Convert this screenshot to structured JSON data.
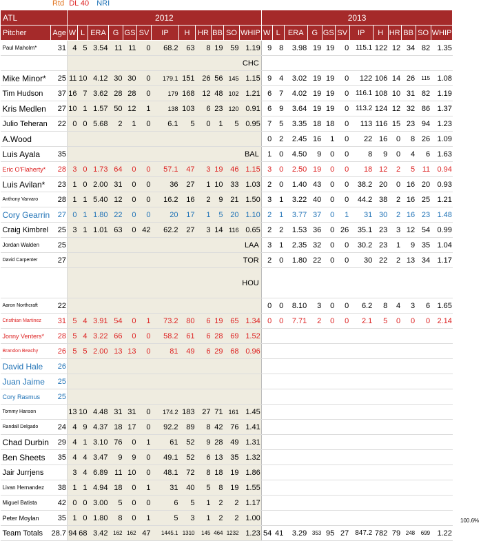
{
  "legend": {
    "rtd": "Rtd",
    "dl40": "DL 40",
    "nri": "NRI"
  },
  "colors": {
    "header_bg": "#a52a2a",
    "red": "#dd2222",
    "blue": "#1f72b6",
    "orange": "#e0701a",
    "year2012_bg": "#efece0"
  },
  "header": {
    "team": "ATL",
    "year1": "2012",
    "year2": "2013",
    "columns": [
      "Pitcher",
      "Age",
      "W",
      "L",
      "ERA",
      "G",
      "GS",
      "SV",
      "IP",
      "H",
      "HR",
      "BB",
      "SO",
      "WHIP",
      "W",
      "L",
      "ERA",
      "G",
      "GS",
      "SV",
      "IP",
      "H",
      "HR",
      "BB",
      "SO",
      "WHIP"
    ]
  },
  "rows": [
    {
      "name": "Paul Maholm*",
      "size": "fs8",
      "age": "31",
      "s12": [
        "4",
        "5",
        "3.54",
        "11",
        "11",
        "0",
        "68.2",
        "63",
        "8",
        "19",
        "59",
        "1.19"
      ],
      "s13": [
        "9",
        "8",
        "3.98",
        "19",
        "19",
        "0",
        "115.1",
        "122",
        "12",
        "34",
        "82",
        "1.35"
      ]
    },
    {
      "team": "CHC"
    },
    {
      "name": "Mike Minor*",
      "size": "fs12",
      "age": "25",
      "s12": [
        "11",
        "10",
        "4.12",
        "30",
        "30",
        "0",
        "179.1",
        "151",
        "26",
        "56",
        "145",
        "1.15"
      ],
      "s13": [
        "9",
        "4",
        "3.02",
        "19",
        "19",
        "0",
        "122",
        "106",
        "14",
        "26",
        "115",
        "1.08"
      ]
    },
    {
      "name": "Tim Hudson",
      "size": "",
      "age": "37",
      "s12": [
        "16",
        "7",
        "3.62",
        "28",
        "28",
        "0",
        "179",
        "168",
        "12",
        "48",
        "102",
        "1.21"
      ],
      "s13": [
        "6",
        "7",
        "4.02",
        "19",
        "19",
        "0",
        "116.1",
        "108",
        "10",
        "31",
        "82",
        "1.19"
      ]
    },
    {
      "name": "Kris Medlen",
      "size": "fs12",
      "age": "27",
      "s12": [
        "10",
        "1",
        "1.57",
        "50",
        "12",
        "1",
        "138",
        "103",
        "6",
        "23",
        "120",
        "0.91"
      ],
      "s13": [
        "6",
        "9",
        "3.64",
        "19",
        "19",
        "0",
        "113.2",
        "124",
        "12",
        "32",
        "86",
        "1.37"
      ]
    },
    {
      "name": "Julio Teheran",
      "size": "",
      "age": "22",
      "s12": [
        "0",
        "0",
        "5.68",
        "2",
        "1",
        "0",
        "6.1",
        "5",
        "0",
        "1",
        "5",
        "0.95"
      ],
      "s13": [
        "7",
        "5",
        "3.35",
        "18",
        "18",
        "0",
        "113",
        "116",
        "15",
        "23",
        "94",
        "1.23"
      ]
    },
    {
      "name": "A.Wood",
      "size": "fs12",
      "age": "",
      "s12": [],
      "s13": [
        "0",
        "2",
        "2.45",
        "16",
        "1",
        "0",
        "22",
        "16",
        "0",
        "8",
        "26",
        "1.09"
      ]
    },
    {
      "name": "Luis Ayala",
      "size": "fs12",
      "age": "35",
      "team": "BAL",
      "s13": [
        "1",
        "0",
        "4.50",
        "9",
        "0",
        "0",
        "8",
        "9",
        "0",
        "4",
        "6",
        "1.63"
      ]
    },
    {
      "name": "Eric O'Flaherty*",
      "size": "fs9",
      "age": "28",
      "color": "red",
      "s12": [
        "3",
        "0",
        "1.73",
        "64",
        "0",
        "0",
        "57.1",
        "47",
        "3",
        "19",
        "46",
        "1.15"
      ],
      "s13": [
        "3",
        "0",
        "2.50",
        "19",
        "0",
        "0",
        "18",
        "12",
        "2",
        "5",
        "11",
        "0.94"
      ]
    },
    {
      "name": "Luis Avilan*",
      "size": "fs12",
      "age": "23",
      "s12": [
        "1",
        "0",
        "2.00",
        "31",
        "0",
        "0",
        "36",
        "27",
        "1",
        "10",
        "33",
        "1.03"
      ],
      "s13": [
        "2",
        "0",
        "1.40",
        "43",
        "0",
        "0",
        "38.2",
        "20",
        "0",
        "16",
        "20",
        "0.93"
      ]
    },
    {
      "name": "Anthony Varvaro",
      "size": "fs7",
      "age": "28",
      "s12": [
        "1",
        "1",
        "5.40",
        "12",
        "0",
        "0",
        "16.2",
        "16",
        "2",
        "9",
        "21",
        "1.50"
      ],
      "s13": [
        "3",
        "1",
        "3.22",
        "40",
        "0",
        "0",
        "44.2",
        "38",
        "2",
        "16",
        "25",
        "1.21"
      ]
    },
    {
      "name": "Cory Gearrin",
      "size": "fs12",
      "age": "27",
      "color": "blue",
      "s12": [
        "0",
        "1",
        "1.80",
        "22",
        "0",
        "0",
        "20",
        "17",
        "1",
        "5",
        "20",
        "1.10"
      ],
      "s13": [
        "2",
        "1",
        "3.77",
        "37",
        "0",
        "1",
        "31",
        "30",
        "2",
        "16",
        "23",
        "1.48"
      ]
    },
    {
      "name": "Craig Kimbrel",
      "size": "",
      "age": "25",
      "s12": [
        "3",
        "1",
        "1.01",
        "63",
        "0",
        "42",
        "62.2",
        "27",
        "3",
        "14",
        "116",
        "0.65"
      ],
      "s13": [
        "2",
        "2",
        "1.53",
        "36",
        "0",
        "26",
        "35.1",
        "23",
        "3",
        "12",
        "54",
        "0.99"
      ]
    },
    {
      "name": "Jordan Walden",
      "size": "fs8",
      "age": "25",
      "team": "LAA",
      "s13": [
        "3",
        "1",
        "2.35",
        "32",
        "0",
        "0",
        "30.2",
        "23",
        "1",
        "9",
        "35",
        "1.04"
      ]
    },
    {
      "name": "David Carpenter",
      "size": "fs7",
      "age": "27",
      "team": "TOR",
      "s13": [
        "2",
        "0",
        "1.80",
        "22",
        "0",
        "0",
        "30",
        "22",
        "2",
        "13",
        "34",
        "1.17"
      ]
    },
    {
      "team": "HOU",
      "tall": true
    },
    {
      "name": "Aaron Northcraft",
      "size": "fs7",
      "age": "22",
      "s12": [],
      "s13": [
        "0",
        "0",
        "8.10",
        "3",
        "0",
        "0",
        "6.2",
        "8",
        "4",
        "3",
        "6",
        "1.65"
      ]
    },
    {
      "name": "Cristhian Martinez",
      "size": "fs7",
      "age": "31",
      "color": "red",
      "s12": [
        "5",
        "4",
        "3.91",
        "54",
        "0",
        "1",
        "73.2",
        "80",
        "6",
        "19",
        "65",
        "1.34"
      ],
      "s13": [
        "0",
        "0",
        "7.71",
        "2",
        "0",
        "0",
        "2.1",
        "5",
        "0",
        "0",
        "0",
        "2.14"
      ]
    },
    {
      "name": "Jonny Venters*",
      "size": "fs9",
      "age": "28",
      "color": "red",
      "s12": [
        "5",
        "4",
        "3.22",
        "66",
        "0",
        "0",
        "58.2",
        "61",
        "6",
        "28",
        "69",
        "1.52"
      ],
      "s13": []
    },
    {
      "name": "Brandon Beachy",
      "size": "fs7",
      "age": "26",
      "color": "red",
      "s12": [
        "5",
        "5",
        "2.00",
        "13",
        "13",
        "0",
        "81",
        "49",
        "6",
        "29",
        "68",
        "0.96"
      ],
      "s13": []
    },
    {
      "name": "David Hale",
      "size": "fs12",
      "age": "26",
      "color": "blue",
      "s12": [],
      "s13": []
    },
    {
      "name": "Juan Jaime",
      "size": "fs12",
      "age": "25",
      "color": "blue",
      "s12": [],
      "s13": []
    },
    {
      "name": "Cory Rasmus",
      "size": "fs9",
      "age": "25",
      "color": "blue",
      "s12": [],
      "s13": []
    },
    {
      "name": "Tommy Hanson",
      "size": "fs7",
      "age": "",
      "s12": [
        "13",
        "10",
        "4.48",
        "31",
        "31",
        "0",
        "174.2",
        "183",
        "27",
        "71",
        "161",
        "1.45"
      ],
      "s13": []
    },
    {
      "name": "Randall Delgado",
      "size": "fs7",
      "age": "24",
      "s12": [
        "4",
        "9",
        "4.37",
        "18",
        "17",
        "0",
        "92.2",
        "89",
        "8",
        "42",
        "76",
        "1.41"
      ],
      "s13": []
    },
    {
      "name": "Chad Durbin",
      "size": "fs12",
      "age": "29",
      "s12": [
        "4",
        "1",
        "3.10",
        "76",
        "0",
        "1",
        "61",
        "52",
        "9",
        "28",
        "49",
        "1.31"
      ],
      "s13": []
    },
    {
      "name": "Ben Sheets",
      "size": "fs12",
      "age": "35",
      "s12": [
        "4",
        "4",
        "3.47",
        "9",
        "9",
        "0",
        "49.1",
        "52",
        "6",
        "13",
        "35",
        "1.32"
      ],
      "s13": []
    },
    {
      "name": "Jair Jurrjens",
      "size": "",
      "age": "",
      "s12": [
        "3",
        "4",
        "6.89",
        "11",
        "10",
        "0",
        "48.1",
        "72",
        "8",
        "18",
        "19",
        "1.86"
      ],
      "s13": []
    },
    {
      "name": "Livan Hernandez",
      "size": "fs8",
      "age": "38",
      "s12": [
        "1",
        "1",
        "4.94",
        "18",
        "0",
        "1",
        "31",
        "40",
        "5",
        "8",
        "19",
        "1.55"
      ],
      "s13": []
    },
    {
      "name": "Miguel Batista",
      "size": "fs8",
      "age": "42",
      "s12": [
        "0",
        "0",
        "3.00",
        "5",
        "0",
        "0",
        "6",
        "5",
        "1",
        "2",
        "2",
        "1.17"
      ],
      "s13": []
    },
    {
      "name": "Peter Moylan",
      "size": "fs9",
      "age": "35",
      "s12": [
        "1",
        "0",
        "1.80",
        "8",
        "0",
        "1",
        "5",
        "3",
        "1",
        "2",
        "2",
        "1.00"
      ],
      "s13": []
    },
    {
      "name": "Team Totals",
      "size": "",
      "age": "28.7",
      "total": true,
      "s12": [
        "94",
        "68",
        "3.42",
        "162",
        "162",
        "47",
        "1445.1",
        "1310",
        "145",
        "464",
        "1232",
        "1.23"
      ],
      "s13": [
        "54",
        "41",
        "3.29",
        "353",
        "95",
        "27",
        "847.2",
        "782",
        "79",
        "248",
        "699",
        "1.22"
      ]
    }
  ],
  "pct": "100.6%"
}
